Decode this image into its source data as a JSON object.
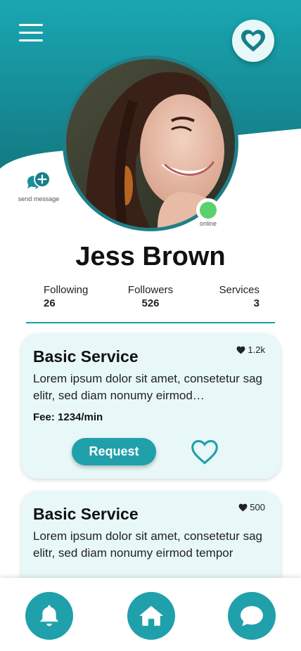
{
  "colors": {
    "teal": "#1fa0ab",
    "teal_dark": "#157f88",
    "card_bg": "#e8f8f8",
    "online": "#5ccf6f"
  },
  "header": {
    "menu_icon": "hamburger-icon",
    "favorite_icon": "heart-icon"
  },
  "send_message": {
    "label": "send message",
    "icon": "chat-plus-icon"
  },
  "profile": {
    "name": "Jess Brown",
    "status_label": "online"
  },
  "stats": [
    {
      "label": "Following",
      "value": "26"
    },
    {
      "label": "Followers",
      "value": "526"
    },
    {
      "label": "Services",
      "value": "3"
    }
  ],
  "services": [
    {
      "title": "Basic Service",
      "likes": "1.2k",
      "description": "Lorem ipsum dolor sit amet, consetetur sag elitr, sed diam nonumy eirmod…",
      "fee": "Fee: 1234/min",
      "request_label": "Request"
    },
    {
      "title": "Basic Service",
      "likes": "500",
      "description": "Lorem ipsum dolor sit amet, consetetur sag elitr, sed diam nonumy eirmod tempor"
    }
  ],
  "bottom_nav": [
    {
      "name": "notifications",
      "icon": "bell-icon"
    },
    {
      "name": "home",
      "icon": "home-icon"
    },
    {
      "name": "messages",
      "icon": "chat-icon"
    }
  ]
}
